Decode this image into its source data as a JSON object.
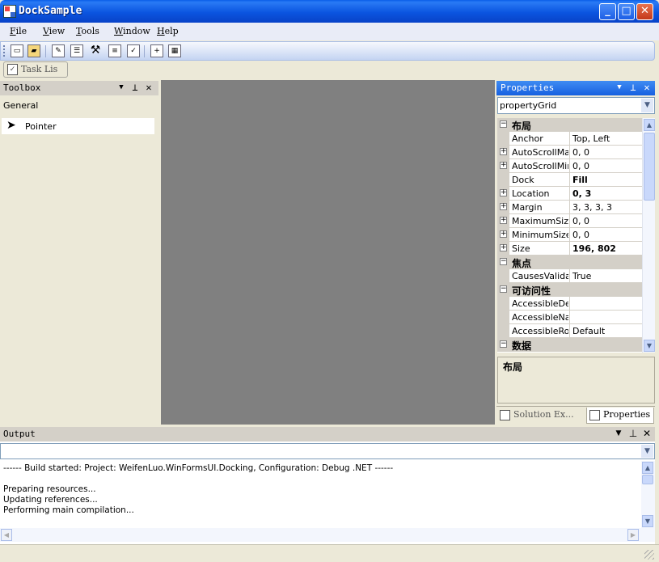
{
  "window": {
    "title": "DockSample"
  },
  "menu": [
    "File",
    "View",
    "Tools",
    "Window",
    "Help"
  ],
  "toolbar": {
    "icons": [
      "new-file-icon",
      "open-folder-icon",
      "solution-explorer-icon",
      "properties-icon",
      "toolbox-icon",
      "output-icon",
      "task-list-icon",
      "new-document-icon",
      "layout-icon"
    ]
  },
  "tasklist_tab": {
    "label": "Task Lis"
  },
  "toolbox": {
    "title": "Toolbox",
    "group": "General",
    "items": [
      {
        "label": "Pointer"
      }
    ]
  },
  "properties": {
    "title": "Properties",
    "selected_object": "propertyGrid",
    "rows": [
      {
        "type": "category",
        "name": "布局"
      },
      {
        "type": "prop",
        "name": "Anchor",
        "value": "Top, Left",
        "expandable": false,
        "bold": false
      },
      {
        "type": "prop",
        "name": "AutoScrollMargin",
        "value": "0, 0",
        "expandable": true,
        "bold": false
      },
      {
        "type": "prop",
        "name": "AutoScrollMinSize",
        "value": "0, 0",
        "expandable": true,
        "bold": false
      },
      {
        "type": "prop",
        "name": "Dock",
        "value": "Fill",
        "expandable": false,
        "bold": true
      },
      {
        "type": "prop",
        "name": "Location",
        "value": "0, 3",
        "expandable": true,
        "bold": true
      },
      {
        "type": "prop",
        "name": "Margin",
        "value": "3, 3, 3, 3",
        "expandable": true,
        "bold": false
      },
      {
        "type": "prop",
        "name": "MaximumSize",
        "value": "0, 0",
        "expandable": true,
        "bold": false
      },
      {
        "type": "prop",
        "name": "MinimumSize",
        "value": "0, 0",
        "expandable": true,
        "bold": false
      },
      {
        "type": "prop",
        "name": "Size",
        "value": "196, 802",
        "expandable": true,
        "bold": true
      },
      {
        "type": "category",
        "name": "焦点"
      },
      {
        "type": "prop",
        "name": "CausesValidation",
        "value": "True",
        "expandable": false,
        "bold": false
      },
      {
        "type": "category",
        "name": "可访问性"
      },
      {
        "type": "prop",
        "name": "AccessibleDescription",
        "value": "",
        "expandable": false,
        "bold": false
      },
      {
        "type": "prop",
        "name": "AccessibleName",
        "value": "",
        "expandable": false,
        "bold": false
      },
      {
        "type": "prop",
        "name": "AccessibleRole",
        "value": "Default",
        "expandable": false,
        "bold": false
      },
      {
        "type": "category",
        "name": "数据"
      }
    ],
    "description_title": "布局",
    "tabs": [
      {
        "label": "Solution Ex..."
      },
      {
        "label": "Properties"
      }
    ]
  },
  "output": {
    "title": "Output",
    "lines": [
      "------ Build started: Project: WeifenLuo.WinFormsUI.Docking, Configuration: Debug .NET ------",
      "",
      "Preparing resources...",
      "Updating references...",
      "Performing main compilation..."
    ]
  }
}
